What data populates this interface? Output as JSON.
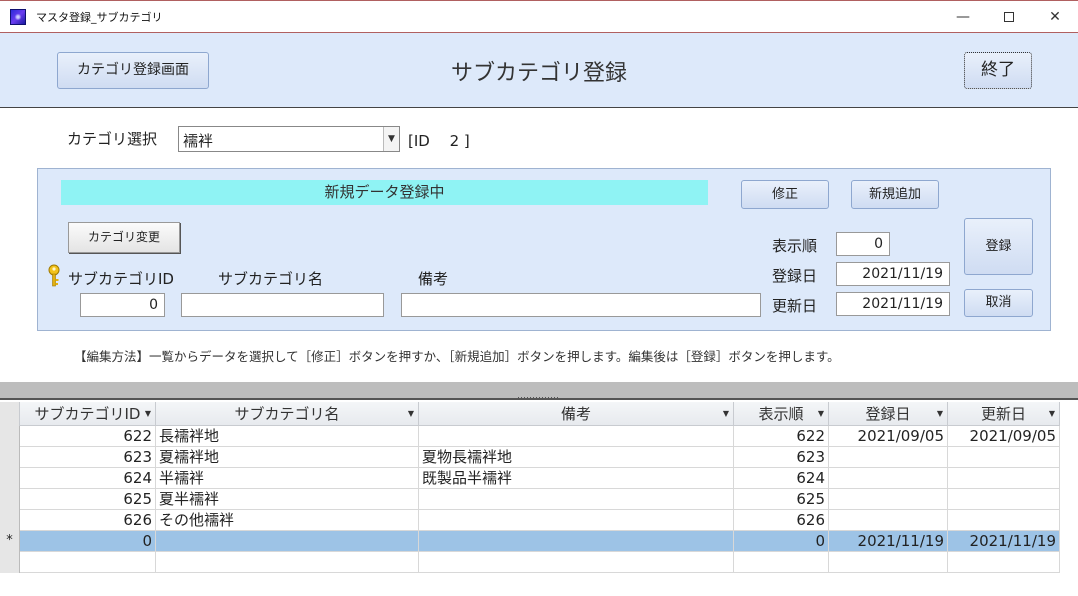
{
  "window": {
    "title": "マスタ登録_サブカテゴリ",
    "minimize": "—",
    "close": "✕"
  },
  "header": {
    "category_screen_button": "カテゴリ登録画面",
    "page_title": "サブカテゴリ登録",
    "end_button": "終了"
  },
  "category": {
    "label": "カテゴリ選択",
    "selected": "襦袢",
    "id_text": "[ID　 2 ]"
  },
  "form": {
    "status": "新規データ登録中",
    "edit_button": "修正",
    "new_button": "新規追加",
    "change_category_button": "カテゴリ変更",
    "display_order_label": "表示順",
    "display_order_value": "0",
    "register_date_label": "登録日",
    "register_date_value": "2021/11/19",
    "update_date_label": "更新日",
    "update_date_value": "2021/11/19",
    "subcategory_id_label": "サブカテゴリID",
    "subcategory_id_value": "0",
    "subcategory_name_label": "サブカテゴリ名",
    "subcategory_name_value": "",
    "note_label": "備考",
    "note_value": "",
    "register_button": "登録",
    "cancel_button": "取消"
  },
  "help_text": "【編集方法】一覧からデータを選択して［修正］ボタンを押すか、［新規追加］ボタンを押します。編集後は［登録］ボタンを押します。",
  "table": {
    "columns": [
      "サブカテゴリID",
      "サブカテゴリ名",
      "備考",
      "表示順",
      "登録日",
      "更新日"
    ],
    "rows": [
      {
        "selector": "",
        "id": "622",
        "name": "長襦袢地",
        "note": "",
        "order": "622",
        "reg": "2021/09/05",
        "upd": "2021/09/05"
      },
      {
        "selector": "",
        "id": "623",
        "name": "夏襦袢地",
        "note": "夏物長襦袢地",
        "order": "623",
        "reg": "",
        "upd": ""
      },
      {
        "selector": "",
        "id": "624",
        "name": "半襦袢",
        "note": "既製品半襦袢",
        "order": "624",
        "reg": "",
        "upd": ""
      },
      {
        "selector": "",
        "id": "625",
        "name": "夏半襦袢",
        "note": "",
        "order": "625",
        "reg": "",
        "upd": ""
      },
      {
        "selector": "",
        "id": "626",
        "name": "その他襦袢",
        "note": "",
        "order": "626",
        "reg": "",
        "upd": ""
      },
      {
        "selector": "*",
        "id": "0",
        "name": "",
        "note": "",
        "order": "0",
        "reg": "2021/11/19",
        "upd": "2021/11/19"
      }
    ]
  },
  "colors": {
    "header_bg": "#dde9fa",
    "status_bg": "#8ff3f4",
    "selected_row": "#9dc3e6"
  },
  "icons": [
    "app-icon",
    "dropdown-arrow-icon",
    "key-icon",
    "sort-arrow-icon",
    "new-record-icon"
  ]
}
